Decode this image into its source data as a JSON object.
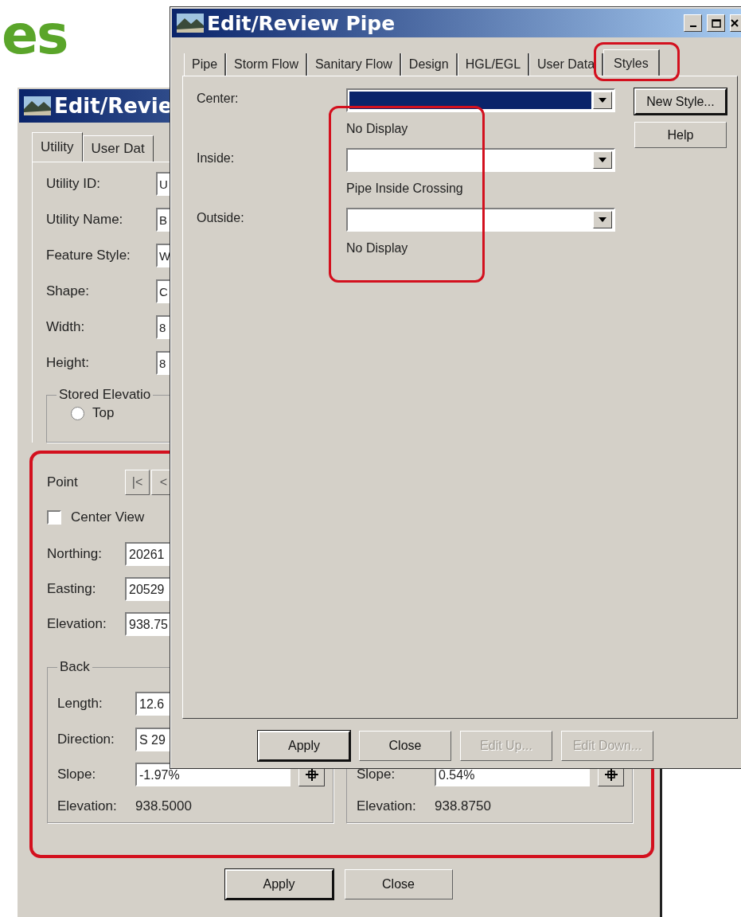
{
  "slide_heading": "es",
  "back_window": {
    "title": "Edit/Revie",
    "tabs": [
      {
        "label": "Utility",
        "selected": true
      },
      {
        "label": "User Dat",
        "selected": false
      }
    ],
    "fields": [
      {
        "label": "Utility ID:",
        "value": "U"
      },
      {
        "label": "Utility Name:",
        "value": "B"
      },
      {
        "label": "Feature Style:",
        "value": "W"
      },
      {
        "label": "Shape:",
        "value": "C"
      },
      {
        "label": "Width:",
        "value": "8"
      },
      {
        "label": "Height:",
        "value": "8"
      }
    ],
    "stored_elevation": {
      "title": "Stored Elevatio",
      "options": [
        {
          "label": "Top",
          "selected": false
        }
      ]
    },
    "point": {
      "label": "Point",
      "nav_buttons": [
        "|<",
        "<"
      ],
      "center_view": {
        "label": "Center View",
        "checked": false
      },
      "fields": [
        {
          "label": "Northing:",
          "value": "20261"
        },
        {
          "label": "Easting:",
          "value": "20529"
        },
        {
          "label": "Elevation:",
          "value": "938.75"
        }
      ]
    },
    "segments": [
      {
        "title": "Back",
        "fields": [
          {
            "label": "Length:",
            "value": "12.6",
            "kind": "text"
          },
          {
            "label": "Direction:",
            "value": "S 29",
            "kind": "text"
          },
          {
            "label": "Slope:",
            "value": "-1.97%",
            "kind": "pick"
          }
        ],
        "elevation_label": "Elevation:",
        "elevation_value": "938.5000"
      },
      {
        "fields": [
          {
            "label": "Slope:",
            "value": "0.54%",
            "kind": "pick"
          }
        ],
        "elevation_label": "Elevation:",
        "elevation_value": "938.8750"
      }
    ],
    "buttons": [
      {
        "label": "Apply",
        "default": true
      },
      {
        "label": "Close",
        "default": false
      }
    ]
  },
  "front_window": {
    "title": "Edit/Review Pipe",
    "tabs": [
      {
        "label": "Pipe",
        "selected": false
      },
      {
        "label": "Storm Flow",
        "selected": false
      },
      {
        "label": "Sanitary Flow",
        "selected": false
      },
      {
        "label": "Design",
        "selected": false
      },
      {
        "label": "HGL/EGL",
        "selected": false
      },
      {
        "label": "User Data",
        "selected": false
      },
      {
        "label": "Styles",
        "selected": true
      }
    ],
    "rows": [
      {
        "label": "Center:",
        "highlighted": true,
        "style": "No Display"
      },
      {
        "label": "Inside:",
        "highlighted": false,
        "style": "Pipe Inside Crossing"
      },
      {
        "label": "Outside:",
        "highlighted": false,
        "style": "No Display"
      }
    ],
    "side_buttons": [
      {
        "label": "New Style...",
        "default": true
      },
      {
        "label": "Help",
        "default": false
      }
    ],
    "buttons": [
      {
        "label": "Apply",
        "default": true,
        "disabled": false
      },
      {
        "label": "Close",
        "default": false,
        "disabled": false
      },
      {
        "label": "Edit Up...",
        "default": false,
        "disabled": true
      },
      {
        "label": "Edit Down...",
        "default": false,
        "disabled": true
      }
    ]
  }
}
